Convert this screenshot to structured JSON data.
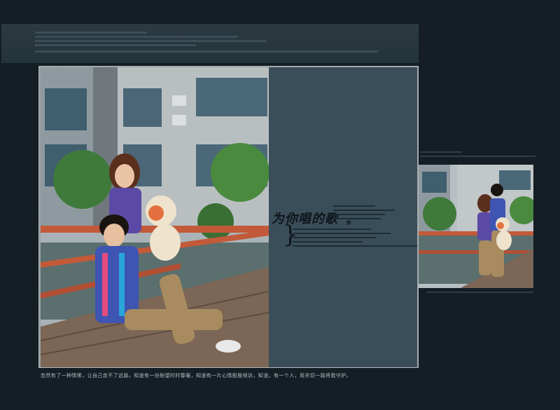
{
  "caption": "忽然有了一种情愫，让自己走不了远路。知道有一份盼望时时春暖，知道有一片心情殷殷倾诉，知道，有一个人，用关切一路将我守护。",
  "title": "为你唱的歌",
  "photos": {
    "main": "couple-sitting-on-boardwalk",
    "secondary": "couple-standing-with-teddy-bear"
  },
  "colors": {
    "background": "#141e24",
    "panel": "#3a4e5a",
    "banner": "#283840",
    "caption_text": "#b7bec1"
  }
}
